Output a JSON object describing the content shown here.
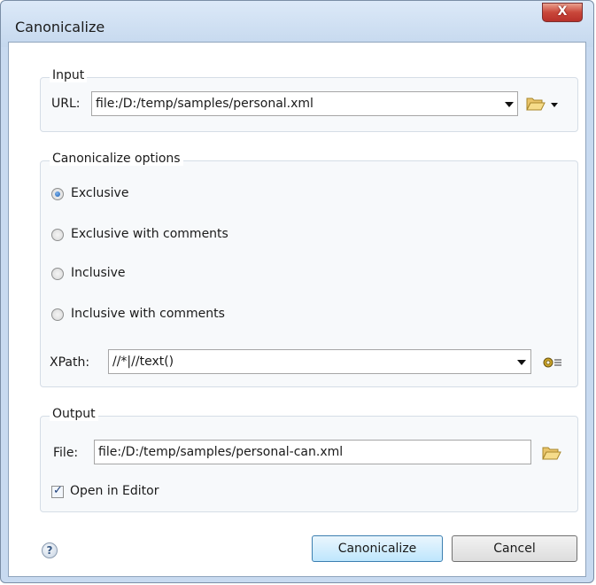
{
  "window": {
    "title": "Canonicalize",
    "close_glyph": "X"
  },
  "input": {
    "legend": "Input",
    "url_label": "URL:",
    "url_value": "file:/D:/temp/samples/personal.xml",
    "browse_icon": "folder-open-icon"
  },
  "options": {
    "legend": "Canonicalize options",
    "radios": [
      {
        "label": "Exclusive",
        "selected": true
      },
      {
        "label": "Exclusive with comments",
        "selected": false
      },
      {
        "label": "Inclusive",
        "selected": false
      },
      {
        "label": "Inclusive with comments",
        "selected": false
      }
    ],
    "xpath_label": "XPath:",
    "xpath_value": "//*|//text()",
    "xpath_settings_icon": "gear-icon"
  },
  "output": {
    "legend": "Output",
    "file_label": "File:",
    "file_value": "file:/D:/temp/samples/personal-can.xml",
    "open_in_editor": "Open in Editor",
    "open_in_editor_checked": true
  },
  "buttons": {
    "help_glyph": "?",
    "canonicalize": "Canonicalize",
    "cancel": "Cancel"
  },
  "colors": {
    "accent": "#1a5fb4",
    "close_button": "#c9473a",
    "window_frame": "#c8daf0"
  }
}
